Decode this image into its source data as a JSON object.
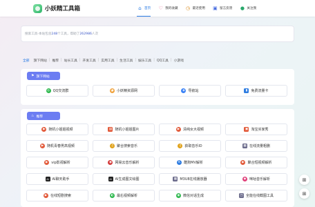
{
  "app": {
    "title": "小妖精工具箱"
  },
  "nav": [
    {
      "label": "首页",
      "icon": "home-icon",
      "glyph": "⌂",
      "color": "#2a7be4"
    },
    {
      "label": "我的收藏",
      "icon": "heart-icon",
      "glyph": "♡",
      "color": "#e25c8a"
    },
    {
      "label": "最近使用",
      "icon": "clock-icon",
      "glyph": "◷",
      "color": "#d98b1d"
    },
    {
      "label": "留言反馈",
      "icon": "chat-icon",
      "glyph": "▣",
      "color": "#4a6ee0"
    },
    {
      "label": "关注我",
      "icon": "user-icon",
      "glyph": "●",
      "color": "#28a86b"
    }
  ],
  "search": {
    "prefix": "搜索工具-本站包含",
    "tool_count": "248",
    "middle": "个工具，帮助了",
    "user_count": "262986",
    "suffix": "人次"
  },
  "categories": [
    "全部",
    "旗下网站",
    "推荐",
    "站长工具",
    "开发工具",
    "实用工具",
    "生活工具",
    "娱乐工具",
    "QQ工具",
    "小游戏"
  ],
  "sections": [
    {
      "title": "旗下网站",
      "icon": "flag-icon",
      "items": [
        {
          "label": "QQ交流群",
          "icon": "qq-icon",
          "color": "#2db84d"
        },
        {
          "label": "小妖精资源网",
          "icon": "cat-icon",
          "color": "#f0a23c"
        },
        {
          "label": "导航站",
          "icon": "compass-icon",
          "color": "#3b82f6"
        },
        {
          "label": "免费流量卡",
          "icon": "sim-card-icon",
          "color": "#2f7de1"
        }
      ]
    },
    {
      "title": "推荐",
      "icon": "fire-icon",
      "items": [
        {
          "label": "随机小姐姐视频",
          "icon": "play-icon",
          "color": "#e25a3a"
        },
        {
          "label": "随机小姐姐图片",
          "icon": "image-icon",
          "color": "#e25a3a"
        },
        {
          "label": "清纯女大视频",
          "icon": "play-icon",
          "color": "#e25a3a"
        },
        {
          "label": "淘宝买家秀",
          "icon": "shop-icon",
          "color": "#e25a3a"
        },
        {
          "label": "随机青春男高视频",
          "icon": "play-icon",
          "color": "#e25a3a"
        },
        {
          "label": "聚合搜索音乐",
          "icon": "music-icon",
          "color": "#e0a21b"
        },
        {
          "label": "获取音乐ID",
          "icon": "music-icon",
          "color": "#e0a21b"
        },
        {
          "label": "在线流量粗删",
          "icon": "film-icon",
          "color": "#6c6c8c"
        },
        {
          "label": "vip影视解析",
          "icon": "play-icon",
          "color": "#e25a3a"
        },
        {
          "label": "网易云音乐解析",
          "icon": "netease-icon",
          "color": "#d33a3a"
        },
        {
          "label": "酷狗MV解析",
          "icon": "kugou-icon",
          "color": "#2f7de1"
        },
        {
          "label": "聚合短视频解析",
          "icon": "play-icon",
          "color": "#e25a3a"
        },
        {
          "label": "AI聊天助手",
          "icon": "ai-icon",
          "color": "#222222"
        },
        {
          "label": "AI生成图文绘图",
          "icon": "ai-icon",
          "color": "#222222"
        },
        {
          "label": "M3U8在线播放器",
          "icon": "film-icon",
          "color": "#6c6c8c"
        },
        {
          "label": "咪咕音乐解析",
          "icon": "migu-icon",
          "color": "#e0407a"
        },
        {
          "label": "在线短剧搜索",
          "icon": "play-icon",
          "color": "#e25a3a"
        },
        {
          "label": "最右视频解析",
          "icon": "zuiyou-icon",
          "color": "#2db84d"
        },
        {
          "label": "微信对话生成",
          "icon": "wechat-icon",
          "color": "#2db84d"
        },
        {
          "label": "全能在线截图工具",
          "icon": "screenshot-icon",
          "color": "#6c6c8c"
        }
      ]
    }
  ],
  "floating": [
    {
      "icon": "grid-icon",
      "glyph": "⊞"
    },
    {
      "icon": "grid-icon",
      "glyph": "⊞"
    }
  ]
}
